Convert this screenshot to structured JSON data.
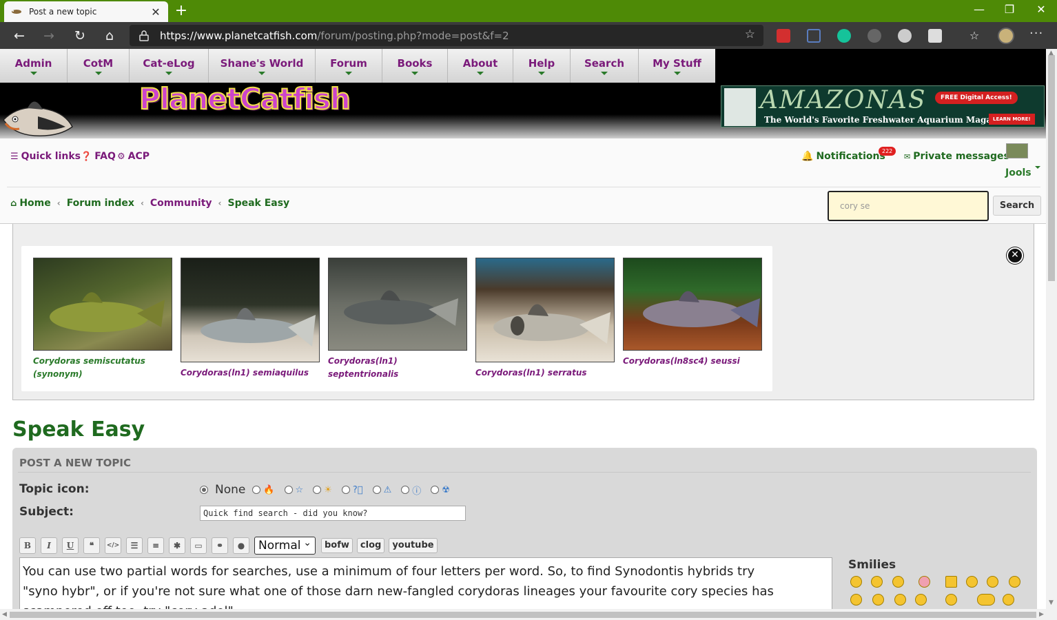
{
  "browser": {
    "tab_title": "Post a new topic",
    "url_host": "https://www.planetcatfish.com",
    "url_path": "/forum/posting.php?mode=post&f=2"
  },
  "site": {
    "menu": [
      "Admin",
      "CotM",
      "Cat-eLog",
      "Shane's World",
      "Forum",
      "Books",
      "About",
      "Help",
      "Search",
      "My Stuff"
    ],
    "logo": "PlanetCatfish",
    "banner": {
      "title": "AMAZONAS",
      "subtitle": "The World's Favorite Freshwater Aquarium Magazine!",
      "free": "FREE Digital Access!",
      "learn": "LEARN MORE!"
    },
    "quick_links": "Quick links",
    "faq": "FAQ",
    "acp": "ACP",
    "notifications": "Notifications",
    "notifications_count": "222",
    "private_messages": "Private messages",
    "username": "Jools",
    "breadcrumbs": [
      "Home",
      "Forum index",
      "Community",
      "Speak Easy"
    ],
    "search_value": "cory se",
    "search_button": "Search"
  },
  "quickfind": {
    "results": [
      {
        "line1": "Corydoras semiscutatus",
        "line2": "(synonym)"
      },
      {
        "line1": "Corydoras(ln1) semiaquilus",
        "line2": ""
      },
      {
        "line1": "Corydoras(ln1) septentrionalis",
        "line2": ""
      },
      {
        "line1": "Corydoras(ln1) serratus",
        "line2": ""
      },
      {
        "line1": "Corydoras(ln8sc4) seussi",
        "line2": ""
      }
    ]
  },
  "post": {
    "forum_title": "Speak Easy",
    "section_title": "POST A NEW TOPIC",
    "topic_icon_label": "Topic icon:",
    "none_label": "None",
    "subject_label": "Subject:",
    "subject_value": "Quick find search - did you know?",
    "size_select": "Normal",
    "custom_buttons": [
      "bofw",
      "clog",
      "youtube"
    ],
    "body_line1": "You can use two partial words for searches, use a minimum of four letters per word. So, to find Synodontis hybrids try",
    "body_line2": "\"syno hybr\", or if you're not sure what one of those darn new-fangled corydoras lineages your favourite cory species has",
    "body_line3": "scampered off too, try \"cory adol\".",
    "smilies_label": "Smilies"
  },
  "colors": {
    "green": "#1f6a1f",
    "purple": "#7a1a7a",
    "titlebar": "#4e8a06"
  }
}
